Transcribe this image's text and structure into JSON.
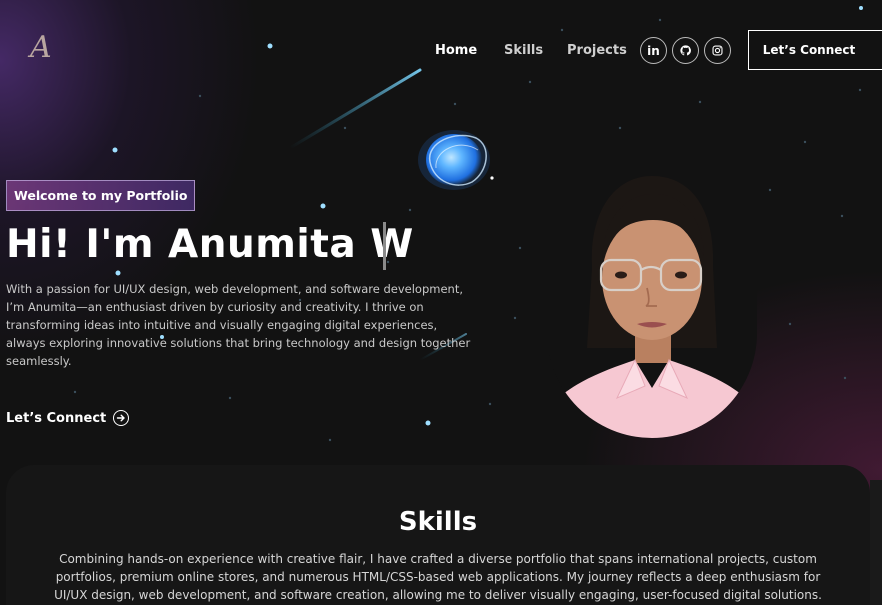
{
  "brand": {
    "logo_text": "A"
  },
  "nav": {
    "home": "Home",
    "skills": "Skills",
    "projects": "Projects",
    "socials": [
      {
        "icon": "linkedin-icon",
        "label": "in"
      },
      {
        "icon": "github-icon",
        "label": ""
      },
      {
        "icon": "instagram-icon",
        "label": ""
      }
    ],
    "cta": "Let’s Connect"
  },
  "hero": {
    "badge": "Welcome to my Portfolio",
    "headline": "Hi! I'm Anumita W",
    "intro": "With a passion for UI/UX design, web development, and software development, I’m Anumita—an enthusiast driven by curiosity and creativity. I thrive on transforming ideas into intuitive and visually engaging digital experiences, always exploring innovative solutions that bring technology and design together seamlessly.",
    "link": "Let’s Connect"
  },
  "skills": {
    "title": "Skills",
    "text": "Combining hands-on experience with creative flair, I have crafted a diverse portfolio that spans international projects, custom portfolios, premium online stores, and numerous HTML/CSS-based web applications. My journey reflects a deep enthusiasm for UI/UX design, web development, and software creation, allowing me to deliver visually engaging, user-focused digital solutions."
  },
  "colors": {
    "background": "#121212",
    "accent_purple": "#6e3caa",
    "accent_pink": "#962870",
    "orb_blue": "#3fa0ff"
  }
}
